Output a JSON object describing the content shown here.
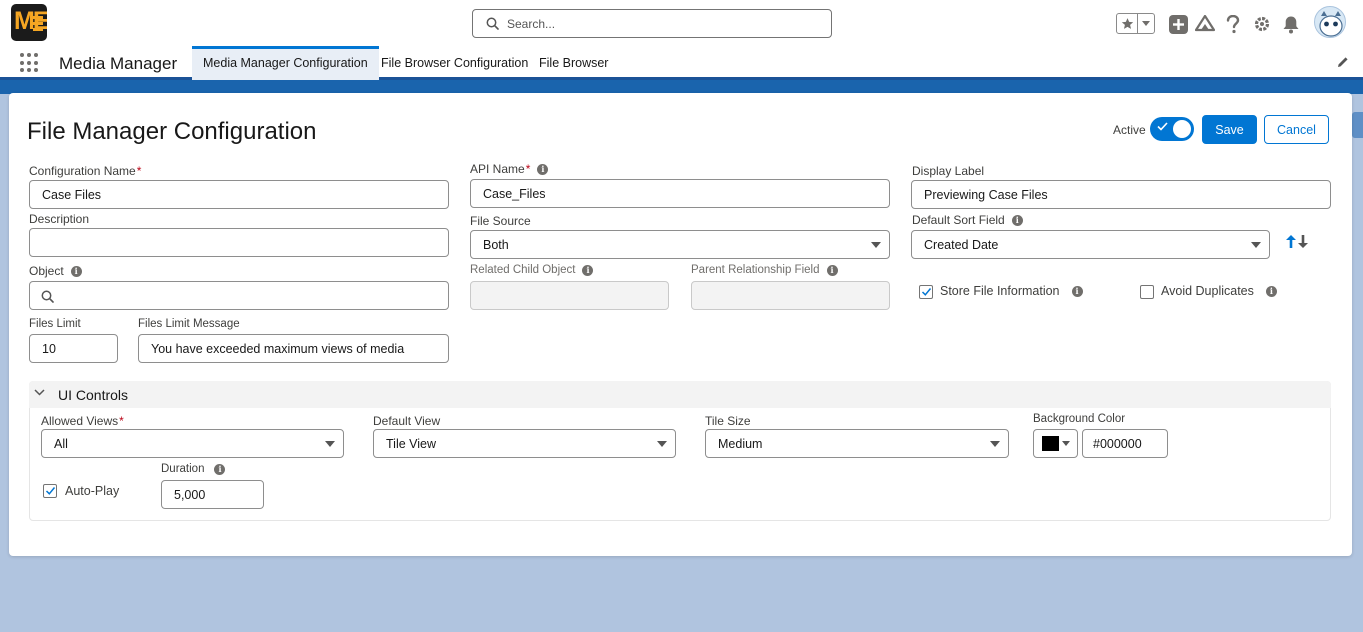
{
  "header": {
    "logo_text": "ME",
    "search_placeholder": "Search...",
    "icons": [
      "star-icon",
      "chevron-down-icon",
      "plus-icon",
      "trailhead-icon",
      "help-icon",
      "gear-icon",
      "bell-icon",
      "avatar"
    ]
  },
  "nav": {
    "app_name": "Media Manager",
    "tabs": [
      {
        "label": "Media Manager Configuration",
        "active": true
      },
      {
        "label": "File Browser Configuration",
        "active": false
      },
      {
        "label": "File Browser",
        "active": false
      }
    ]
  },
  "page": {
    "title": "File Manager Configuration",
    "active_label": "Active",
    "active": true,
    "save_label": "Save",
    "cancel_label": "Cancel"
  },
  "form": {
    "config_name": {
      "label": "Configuration Name",
      "value": "Case Files",
      "required": "*"
    },
    "api_name": {
      "label": "API Name",
      "value": "Case_Files",
      "required": "*"
    },
    "display_label": {
      "label": "Display Label",
      "value": "Previewing Case Files"
    },
    "description": {
      "label": "Description",
      "value": ""
    },
    "file_source": {
      "label": "File Source",
      "value": "Both"
    },
    "default_sort_field": {
      "label": "Default Sort Field",
      "value": "Created Date"
    },
    "object": {
      "label": "Object",
      "value": ""
    },
    "related_child_object": {
      "label": "Related Child Object",
      "value": ""
    },
    "parent_relationship_field": {
      "label": "Parent Relationship Field",
      "value": ""
    },
    "store_file_information": {
      "label": "Store File Information",
      "checked": true
    },
    "avoid_duplicates": {
      "label": "Avoid Duplicates",
      "checked": false
    },
    "files_limit": {
      "label": "Files Limit",
      "value": "10"
    },
    "files_limit_message": {
      "label": "Files Limit Message",
      "value": "You have exceeded maximum views of media"
    }
  },
  "ui_controls": {
    "title": "UI Controls",
    "allowed_views": {
      "label": "Allowed Views",
      "value": "All",
      "required": "*"
    },
    "default_view": {
      "label": "Default View",
      "value": "Tile View"
    },
    "tile_size": {
      "label": "Tile Size",
      "value": "Medium"
    },
    "background_color": {
      "label": "Background Color",
      "value": "#000000"
    },
    "auto_play": {
      "label": "Auto-Play",
      "checked": true
    },
    "duration": {
      "label": "Duration",
      "value": "5,000"
    }
  },
  "colors": {
    "brand_blue": "#0176d3",
    "header_stripe": "#1a64ad",
    "background": "#b0c4df"
  }
}
